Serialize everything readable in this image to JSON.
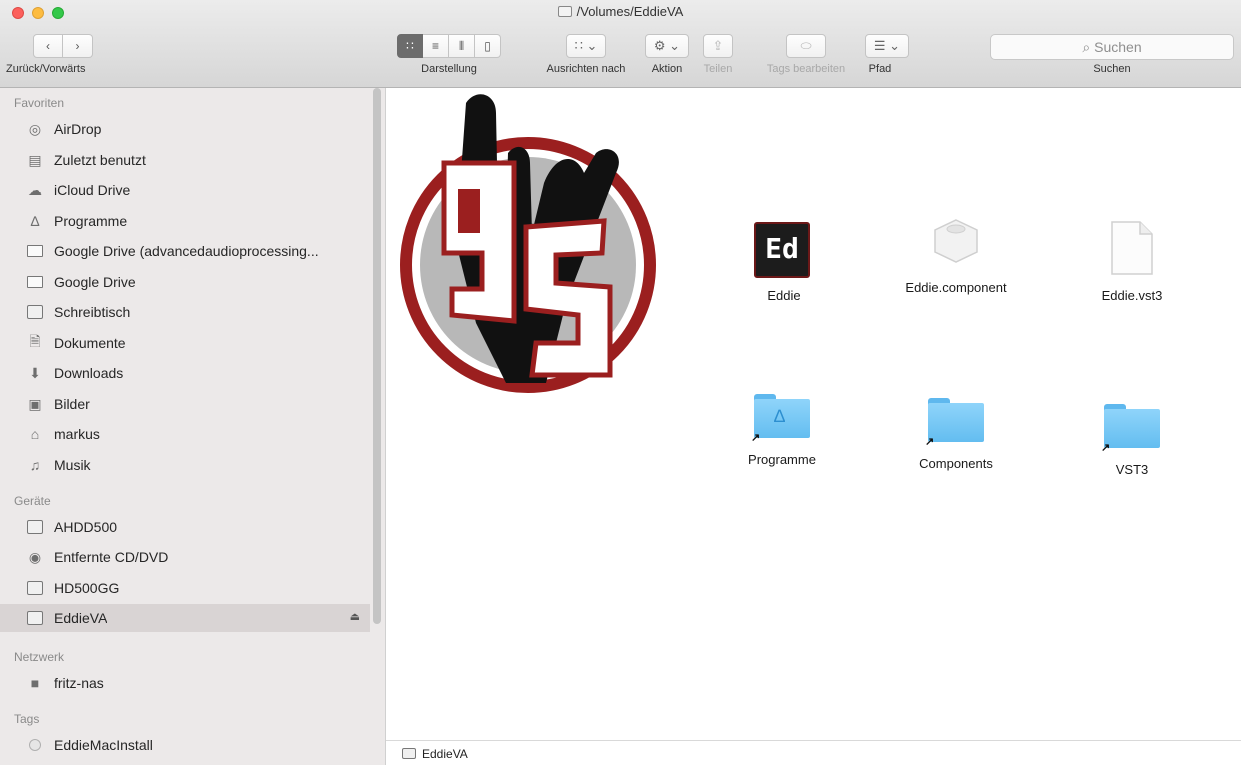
{
  "window": {
    "title": "/Volumes/EddieVA"
  },
  "toolbar": {
    "nav_label": "Zurück/Vorwärts",
    "view_label": "Darstellung",
    "arrange_label": "Ausrichten nach",
    "action_label": "Aktion",
    "share_label": "Teilen",
    "tags_label": "Tags bearbeiten",
    "path_label": "Pfad",
    "search_label": "Suchen",
    "search_placeholder": "Suchen",
    "active_view": "icon"
  },
  "sidebar": {
    "favorites_header": "Favoriten",
    "favorites": [
      {
        "label": "AirDrop",
        "icon": "airdrop-icon"
      },
      {
        "label": "Zuletzt benutzt",
        "icon": "recents-icon"
      },
      {
        "label": "iCloud Drive",
        "icon": "cloud-icon"
      },
      {
        "label": "Programme",
        "icon": "applications-icon"
      },
      {
        "label": "Google Drive (advancedaudioprocessing...",
        "icon": "folder-icon"
      },
      {
        "label": "Google Drive",
        "icon": "folder-icon"
      },
      {
        "label": "Schreibtisch",
        "icon": "desktop-icon"
      },
      {
        "label": "Dokumente",
        "icon": "documents-icon"
      },
      {
        "label": "Downloads",
        "icon": "downloads-icon"
      },
      {
        "label": "Bilder",
        "icon": "pictures-icon"
      },
      {
        "label": "markus",
        "icon": "home-icon"
      },
      {
        "label": "Musik",
        "icon": "music-icon"
      }
    ],
    "devices_header": "Geräte",
    "devices": [
      {
        "label": "AHDD500",
        "icon": "disk-icon"
      },
      {
        "label": "Entfernte CD/DVD",
        "icon": "cd-icon"
      },
      {
        "label": "HD500GG",
        "icon": "disk-icon"
      },
      {
        "label": "EddieVA",
        "icon": "drive-icon",
        "selected": true
      }
    ],
    "network_header": "Netzwerk",
    "network": [
      {
        "label": "fritz-nas",
        "icon": "server-icon"
      }
    ],
    "tags_header": "Tags",
    "tags": [
      {
        "label": "EddieMacInstall",
        "icon": "tag-dot-icon",
        "color": "#c8c8c8"
      }
    ]
  },
  "files": [
    {
      "label": "Eddie",
      "icon": "app-icon"
    },
    {
      "label": "Eddie.component",
      "icon": "component-icon"
    },
    {
      "label": "Eddie.vst3",
      "icon": "document-icon"
    },
    {
      "label": "Programme",
      "icon": "folder-alias-icon"
    },
    {
      "label": "Components",
      "icon": "folder-alias-icon"
    },
    {
      "label": "VST3",
      "icon": "folder-alias-icon"
    }
  ],
  "app_icon_text": "Ed",
  "background_logo_text": "9S",
  "pathbar": {
    "label": "EddieVA"
  },
  "colors": {
    "logo_red": "#9b1f1f",
    "folder_blue": "#63bdf0",
    "selection": "#d9d4d4"
  }
}
